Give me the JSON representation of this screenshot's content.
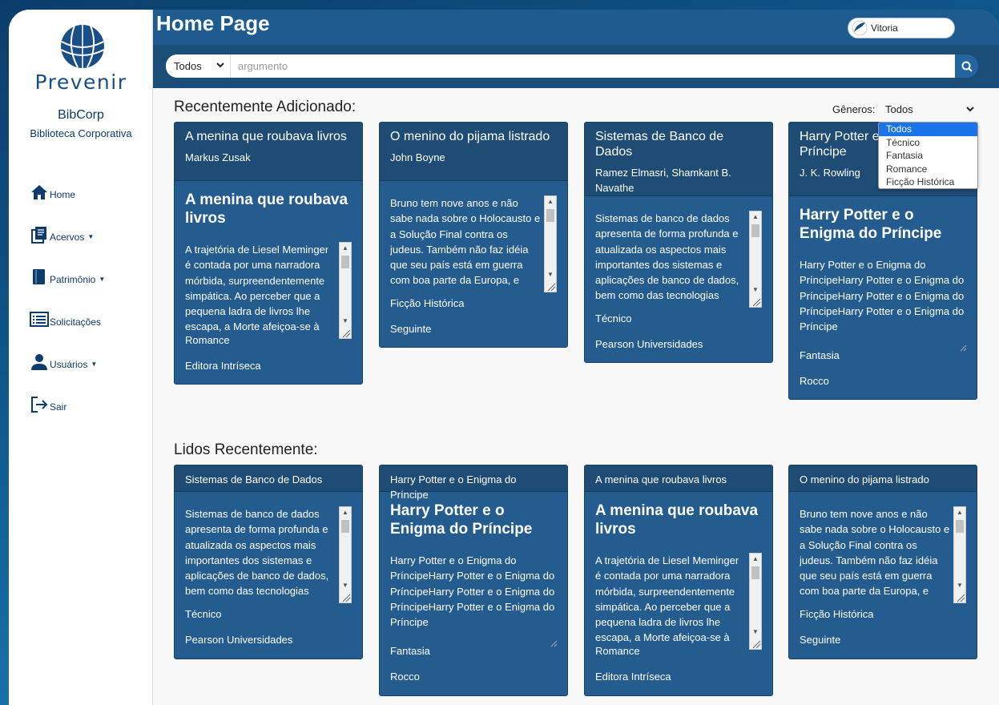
{
  "sidebar": {
    "logo_text": "Prevenir",
    "org_name": "BibCorp",
    "org_subtitle": "Biblioteca Corporativa",
    "items": [
      {
        "label": "Home",
        "icon": "home-icon",
        "has_caret": false
      },
      {
        "label": "Acervos",
        "icon": "books-icon",
        "has_caret": true
      },
      {
        "label": "Patrimônio",
        "icon": "book-icon",
        "has_caret": true
      },
      {
        "label": "Solicitações",
        "icon": "list-icon",
        "has_caret": false
      },
      {
        "label": "Usuários",
        "icon": "user-icon",
        "has_caret": true
      },
      {
        "label": "Sair",
        "icon": "logout-icon",
        "has_caret": false
      }
    ]
  },
  "header": {
    "title": "Home Page",
    "user_name": "Vitoria",
    "search": {
      "selected": "Todos",
      "placeholder": "argumento"
    }
  },
  "filter": {
    "label": "Gêneros:",
    "selected": "Todos",
    "options": [
      "Todos",
      "Técnico",
      "Fantasia",
      "Romance",
      "Ficção Histórica"
    ]
  },
  "sections": {
    "recent_added": "Recentemente Adicionado:",
    "recent_read": "Lidos Recentemente:"
  },
  "cards_added": [
    {
      "title": "A menina que roubava livros",
      "author": "Markus Zusak",
      "big_title": "A menina que roubava livros",
      "description": "A trajetória de Liesel Meminger é contada por uma narradora mórbida, surpreendentemente simpática. Ao perceber que a pequena ladra de livros lhe escapa, a Morte afeiçoa-se à menina",
      "genre": "Romance",
      "publisher": "Editora Intríseca"
    },
    {
      "title": "O menino do pijama listrado",
      "author": "John Boyne",
      "big_title": "",
      "description": "Bruno tem nove anos e não sabe nada sobre o Holocausto e a Solução Final contra os judeus. Também não faz idéia que seu país está em guerra com boa parte da Europa, e muito menos que sua família está envolvida",
      "genre": "Ficção Histórica",
      "publisher": "Seguinte"
    },
    {
      "title": "Sistemas de Banco de Dados",
      "author": "Ramez Elmasri, Shamkant B. Navathe",
      "big_title": "",
      "description": "Sistemas de banco de dados apresenta de forma profunda e atualizada os aspectos mais importantes dos sistemas e aplicações de banco de dados, bem como das tecnologias relacionadas. Este livro",
      "genre": "Técnico",
      "publisher": "Pearson Universidades"
    },
    {
      "title": "Harry Potter e o Enigma do Príncipe",
      "author": "J. K. Rowling",
      "big_title": "Harry Potter e o Enigma do Príncipe",
      "description": "Harry Potter e o Enigma do PríncipeHarry Potter e o Enigma do PríncipeHarry Potter e o Enigma do PríncipeHarry Potter e o Enigma do Príncipe",
      "genre": "Fantasia",
      "publisher": "Rocco"
    }
  ],
  "cards_read": [
    {
      "title": "Sistemas de Banco de Dados",
      "big_title": "",
      "description": "Sistemas de banco de dados apresenta de forma profunda e atualizada os aspectos mais importantes dos sistemas e aplicações de banco de dados, bem como das tecnologias relacionadas. Este livro",
      "genre": "Técnico",
      "publisher": "Pearson Universidades"
    },
    {
      "title": "Harry Potter e o Enigma do Príncipe",
      "big_title": "Harry Potter e o Enigma do Príncipe",
      "description": "Harry Potter e o Enigma do PríncipeHarry Potter e o Enigma do PríncipeHarry Potter e o Enigma do PríncipeHarry Potter e o Enigma do Príncipe",
      "genre": "Fantasia",
      "publisher": "Rocco"
    },
    {
      "title": "A menina que roubava livros",
      "big_title": "A menina que roubava livros",
      "description": "A trajetória de Liesel Meminger é contada por uma narradora mórbida, surpreendentemente simpática. Ao perceber que a pequena ladra de livros lhe escapa, a Morte afeiçoa-se à menina",
      "genre": "Romance",
      "publisher": "Editora Intríseca"
    },
    {
      "title": "O menino do pijama listrado",
      "big_title": "",
      "description": "Bruno tem nove anos e não sabe nada sobre o Holocausto e a Solução Final contra os judeus. Também não faz idéia que seu país está em guerra com boa parte da Europa, e muito menos que sua família está envolvida",
      "genre": "Ficção Histórica",
      "publisher": "Seguinte"
    }
  ],
  "colors": {
    "header": "#1b4d79",
    "card": "#245c8f",
    "card_head": "#1f4c74",
    "accent": "#1a73e8"
  }
}
